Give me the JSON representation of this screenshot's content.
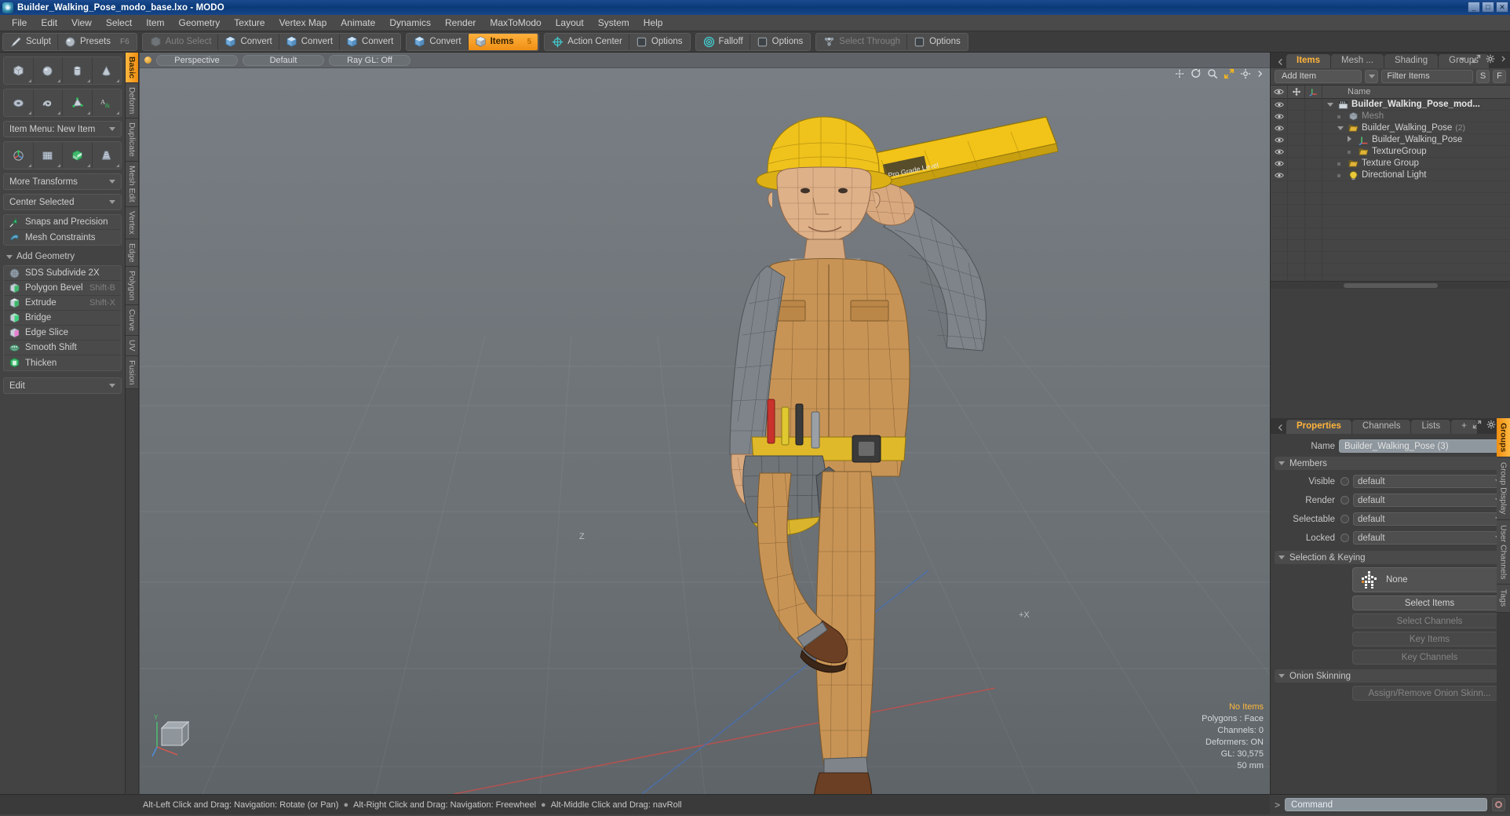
{
  "titlebar": {
    "title": "Builder_Walking_Pose_modo_base.lxo - MODO",
    "app_icon": "modo-logo-icon",
    "buttons": [
      "minimize",
      "maximize",
      "close"
    ]
  },
  "menubar": {
    "items": [
      "File",
      "Edit",
      "View",
      "Select",
      "Item",
      "Geometry",
      "Texture",
      "Vertex Map",
      "Animate",
      "Dynamics",
      "Render",
      "MaxToModo",
      "Layout",
      "System",
      "Help"
    ]
  },
  "toolbar": {
    "group1": [
      {
        "label": "Sculpt",
        "icon": "pencil-icon",
        "state": "normal"
      },
      {
        "label": "Presets",
        "icon": "sphere-icon",
        "state": "normal",
        "shortcut": "F6"
      }
    ],
    "group2": [
      {
        "label": "Auto Select",
        "icon": "cube-gray-icon",
        "state": "disabled"
      },
      {
        "label": "Convert",
        "icon": "cube-blue-icon",
        "state": "normal"
      },
      {
        "label": "Convert",
        "icon": "cube-blue-icon",
        "state": "normal"
      },
      {
        "label": "Convert",
        "icon": "cube-blue-icon",
        "state": "normal"
      }
    ],
    "group3": [
      {
        "label": "Convert",
        "icon": "cube-blue-icon",
        "state": "normal"
      },
      {
        "label": "Items",
        "icon": "cube-orange-icon",
        "state": "active",
        "badge": "5"
      }
    ],
    "group4": [
      {
        "label": "Action Center",
        "icon": "crosshair-icon",
        "state": "normal"
      },
      {
        "label": "Options",
        "icon": "square-icon",
        "state": "normal"
      }
    ],
    "group5": [
      {
        "label": "Falloff",
        "icon": "target-icon",
        "state": "normal"
      },
      {
        "label": "Options",
        "icon": "square-icon",
        "state": "normal"
      }
    ],
    "group6": [
      {
        "label": "Select Through",
        "icon": "nodes-icon",
        "state": "disabled"
      },
      {
        "label": "Options",
        "icon": "square-icon",
        "state": "normal"
      }
    ]
  },
  "left_panel": {
    "primitive_row1": [
      "cube-icon",
      "sphere-icon",
      "cylinder-icon",
      "cone-icon"
    ],
    "primitive_row2": [
      "torus-icon",
      "spiral-icon",
      "mesh-poly-icon",
      "text-icon"
    ],
    "item_menu": "Item Menu: New Item",
    "transform_row": [
      "transform-gizmo-icon",
      "grid-plane-icon",
      "checker-cube-icon",
      "taper-icon"
    ],
    "more_transforms": "More Transforms",
    "center_selected": "Center Selected",
    "snaps": [
      {
        "label": "Snaps and Precision",
        "icon": "snap-arrow-icon"
      },
      {
        "label": "Mesh Constraints",
        "icon": "mesh-constraint-icon"
      }
    ],
    "add_geometry_header": "Add Geometry",
    "geometry_items": [
      {
        "label": "SDS Subdivide 2X",
        "icon": "sds-subdivide-icon",
        "shortcut": ""
      },
      {
        "label": "Polygon Bevel",
        "icon": "bevel-icon",
        "shortcut": "Shift-B"
      },
      {
        "label": "Extrude",
        "icon": "extrude-icon",
        "shortcut": "Shift-X"
      },
      {
        "label": "Bridge",
        "icon": "bridge-icon",
        "shortcut": ""
      },
      {
        "label": "Edge Slice",
        "icon": "edge-slice-icon",
        "shortcut": ""
      },
      {
        "label": "Smooth Shift",
        "icon": "smooth-shift-icon",
        "shortcut": ""
      },
      {
        "label": "Thicken",
        "icon": "thicken-icon",
        "shortcut": ""
      }
    ],
    "edit_dropdown": "Edit",
    "vertical_tabs": [
      {
        "label": "Basic",
        "active": true
      },
      {
        "label": "Deform",
        "active": false
      },
      {
        "label": "Duplicate",
        "active": false
      },
      {
        "label": "Mesh Edit",
        "active": false
      },
      {
        "label": "Vertex",
        "active": false
      },
      {
        "label": "Edge",
        "active": false
      },
      {
        "label": "Polygon",
        "active": false
      },
      {
        "label": "Curve",
        "active": false
      },
      {
        "label": "UV",
        "active": false
      },
      {
        "label": "Fusion",
        "active": false
      }
    ]
  },
  "viewport": {
    "view_mode": "Perspective",
    "shading": "Default",
    "ray_gl": "Ray GL: Off",
    "header_icons": [
      "move-icon",
      "rotate-icon",
      "zoom-icon",
      "fit-icon",
      "settings-icon",
      "menu-icon"
    ],
    "stats": {
      "items": "No Items",
      "polygons": "Polygons : Face",
      "channels": "Channels: 0",
      "deformers": "Deformers: ON",
      "gl": "GL: 30,575",
      "scale": "50 mm"
    },
    "gizmo_axes": [
      "Y",
      "X",
      "Z"
    ],
    "model_description": "Wireframe 3D character of a construction worker wearing a yellow hard hat, tan coveralls with plaid flannel sleeves, a tool belt with tools, brown boots, carrying a yellow level tool over the shoulder"
  },
  "right_panel": {
    "tabs": [
      {
        "label": "Items",
        "active": true
      },
      {
        "label": "Mesh ...",
        "active": false
      },
      {
        "label": "Shading",
        "active": false
      },
      {
        "label": "Groups",
        "active": false
      }
    ],
    "tab_tools": [
      "chevron-down-icon",
      "expand-icon",
      "gear-icon",
      "chevron-right-icon"
    ],
    "add_item": "Add Item",
    "filter_placeholder": "Filter Items",
    "filter_buttons": [
      "S",
      "F"
    ],
    "tree_columns": [
      "eye-icon",
      "move-icon",
      "axis-icon",
      "Name"
    ],
    "tree_rows": [
      {
        "label": "Builder_Walking_Pose_mod...",
        "indent": 0,
        "icon": "scene-clapper-icon",
        "bold": true,
        "twirl": "down",
        "count": ""
      },
      {
        "label": "Mesh",
        "indent": 1,
        "icon": "cube-icon",
        "dim": true,
        "twirl": "",
        "count": ""
      },
      {
        "label": "Builder_Walking_Pose",
        "indent": 1,
        "icon": "folder-icon",
        "twirl": "down",
        "count": "(2)"
      },
      {
        "label": "Builder_Walking_Pose",
        "indent": 2,
        "icon": "mesh-axis-icon",
        "twirl": "right",
        "count": ""
      },
      {
        "label": "TextureGroup",
        "indent": 2,
        "icon": "folder-icon",
        "twirl": "",
        "count": ""
      },
      {
        "label": "Texture Group",
        "indent": 1,
        "icon": "folder-icon",
        "twirl": "",
        "count": ""
      },
      {
        "label": "Directional Light",
        "indent": 1,
        "icon": "light-icon",
        "twirl": "",
        "count": ""
      }
    ],
    "properties": {
      "tabs": [
        {
          "label": "Properties",
          "active": true
        },
        {
          "label": "Channels",
          "active": false
        },
        {
          "label": "Lists",
          "active": false
        },
        {
          "label": "+",
          "active": false
        }
      ],
      "name_label": "Name",
      "name_value": "Builder_Walking_Pose (3)",
      "members_header": "Members",
      "member_rows": [
        {
          "label": "Visible",
          "value": "default"
        },
        {
          "label": "Render",
          "value": "default"
        },
        {
          "label": "Selectable",
          "value": "default"
        },
        {
          "label": "Locked",
          "value": "default"
        }
      ],
      "selection_header": "Selection & Keying",
      "selection_set": "None",
      "selection_set_icon": "selection-set-icon",
      "buttons": [
        {
          "label": "Select Items",
          "disabled": false
        },
        {
          "label": "Select Channels",
          "disabled": true
        },
        {
          "label": "Key Items",
          "disabled": true
        },
        {
          "label": "Key Channels",
          "disabled": true
        }
      ],
      "onion_header": "Onion Skinning",
      "onion_button": {
        "label": "Assign/Remove Onion Skinn...",
        "disabled": true
      }
    },
    "vertical_tabs": [
      {
        "label": "Groups",
        "active": true
      },
      {
        "label": "Group Display",
        "active": false
      },
      {
        "label": "User Channels",
        "active": false
      },
      {
        "label": "Tags",
        "active": false
      }
    ]
  },
  "statusbar": {
    "hints": [
      "Alt-Left Click and Drag: Navigation: Rotate (or Pan)",
      "Alt-Right Click and Drag: Navigation: Freewheel",
      "Alt-Middle Click and Drag: navRoll"
    ]
  },
  "command_bar": {
    "prompt": ">",
    "placeholder": "Command",
    "record_icon": "record-icon"
  },
  "colors": {
    "accent_orange": "#f09010",
    "title_blue": "#0b3a78",
    "panel_bg": "#3f3f3f",
    "viewport_bg": "#6e7479",
    "stat_highlight": "#ffb83d"
  }
}
